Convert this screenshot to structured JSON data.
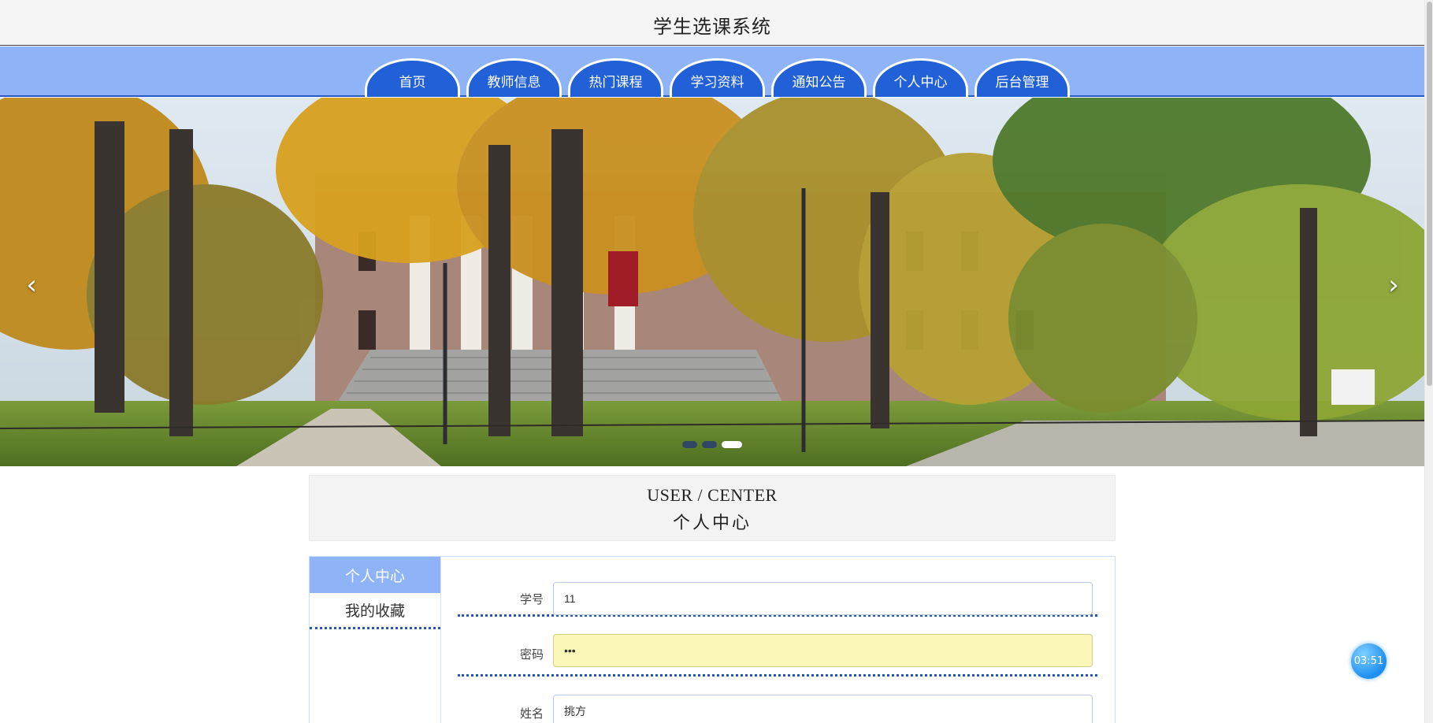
{
  "header": {
    "title": "学生选课系统"
  },
  "nav": {
    "tabs": [
      "首页",
      "教师信息",
      "热门课程",
      "学习资料",
      "通知公告",
      "个人中心",
      "后台管理"
    ]
  },
  "carousel": {
    "prev_icon": "chevron-left-icon",
    "next_icon": "chevron-right-icon",
    "prev_glyph": "‹",
    "next_glyph": "›",
    "slide_count": 3,
    "active_slide": 3
  },
  "section": {
    "title_en": "USER / CENTER",
    "title_cn": "个人中心"
  },
  "side_menu": {
    "items": [
      "个人中心",
      "我的收藏"
    ],
    "active": "个人中心"
  },
  "form": {
    "fields": [
      {
        "label": "学号",
        "value": "11"
      },
      {
        "label": "密码",
        "value": "•••"
      },
      {
        "label": "姓名",
        "value": "挑方"
      }
    ]
  },
  "timer": {
    "value": "03:51"
  },
  "colors": {
    "nav_bg": "#8eb4f7",
    "tab_bg": "#2160d6",
    "active_menu": "#8eb4f7",
    "divider": "#2558b3",
    "autofill": "#fbf7b8"
  }
}
